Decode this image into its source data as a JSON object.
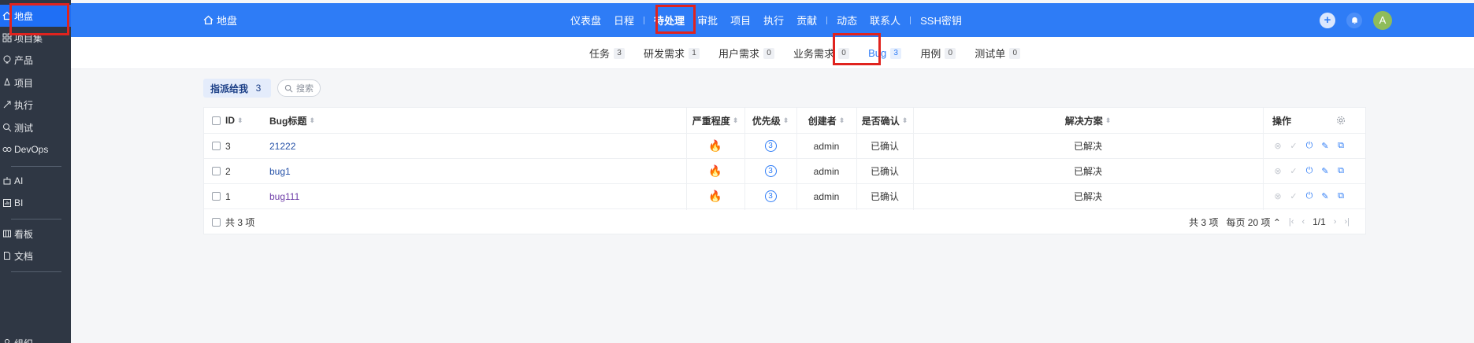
{
  "sidebar": {
    "items": [
      {
        "label": "地盘",
        "icon": "home-icon",
        "active": true
      },
      {
        "label": "项目集",
        "icon": "grid-icon"
      },
      {
        "label": "产品",
        "icon": "bulb-icon"
      },
      {
        "label": "项目",
        "icon": "rocket-icon"
      },
      {
        "label": "执行",
        "icon": "run-icon"
      },
      {
        "label": "测试",
        "icon": "magnifier-icon"
      },
      {
        "label": "DevOps",
        "icon": "infinity-icon"
      },
      {
        "label": "AI",
        "icon": "robot-icon"
      },
      {
        "label": "BI",
        "icon": "chart-icon"
      },
      {
        "label": "看板",
        "icon": "kanban-icon"
      },
      {
        "label": "文档",
        "icon": "doc-icon"
      },
      {
        "label": "组织",
        "icon": "org-icon"
      }
    ]
  },
  "topbar": {
    "home": "地盘",
    "nav": [
      "仪表盘",
      "日程",
      "待处理",
      "审批",
      "项目",
      "执行",
      "贡献",
      "动态",
      "联系人",
      "SSH密钥"
    ],
    "avatar": "A"
  },
  "subnav": {
    "tabs": [
      {
        "label": "任务",
        "count": "3"
      },
      {
        "label": "研发需求",
        "count": "1"
      },
      {
        "label": "用户需求",
        "count": "0"
      },
      {
        "label": "业务需求",
        "count": "0"
      },
      {
        "label": "Bug",
        "count": "3",
        "active": true
      },
      {
        "label": "用例",
        "count": "0"
      },
      {
        "label": "测试单",
        "count": "0"
      }
    ]
  },
  "filter": {
    "label": "指派给我",
    "count": "3",
    "search_placeholder": "搜索"
  },
  "table": {
    "columns": {
      "id": "ID",
      "title": "Bug标题",
      "severity": "严重程度",
      "priority": "优先级",
      "creator": "创建者",
      "confirmed": "是否确认",
      "resolution": "解决方案",
      "actions": "操作"
    },
    "rows": [
      {
        "id": "3",
        "title": "21222",
        "priority": "3",
        "creator": "admin",
        "confirmed": "已确认",
        "resolution": "已解决"
      },
      {
        "id": "2",
        "title": "bug1",
        "priority": "3",
        "creator": "admin",
        "confirmed": "已确认",
        "resolution": "已解决"
      },
      {
        "id": "1",
        "title": "bug111",
        "priority": "3",
        "creator": "admin",
        "confirmed": "已确认",
        "resolution": "已解决"
      }
    ],
    "footer_total": "共 3 项",
    "pager": {
      "total": "共 3 项",
      "per_page": "每页 20 项",
      "page": "1/1"
    }
  },
  "colors": {
    "primary": "#2e7cf6",
    "sidebar_bg": "#2f3744",
    "highlight": "#e0231e"
  }
}
